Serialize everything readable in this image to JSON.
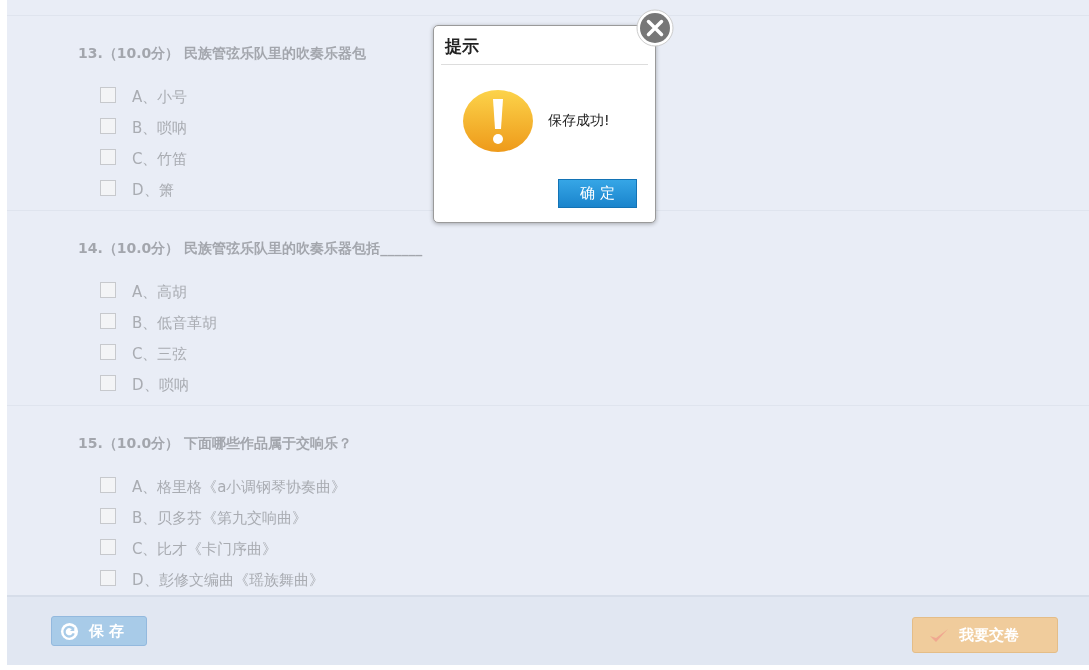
{
  "questions": [
    {
      "number": "13.",
      "score": "（10.0分）",
      "text": "民族管弦乐队里的吹奏乐器包",
      "options": [
        {
          "label": "A、小号",
          "checked": false
        },
        {
          "label": "B、唢呐",
          "checked": false
        },
        {
          "label": "C、竹笛",
          "checked": false
        },
        {
          "label": "D、箫",
          "checked": false
        }
      ]
    },
    {
      "number": "14.",
      "score": "（10.0分）",
      "text": "民族管弦乐队里的吹奏乐器包括______",
      "options": [
        {
          "label": "A、高胡",
          "checked": false
        },
        {
          "label": "B、低音革胡",
          "checked": false
        },
        {
          "label": "C、三弦",
          "checked": false
        },
        {
          "label": "D、唢呐",
          "checked": false
        }
      ]
    },
    {
      "number": "15.",
      "score": "（10.0分）",
      "text": "下面哪些作品属于交响乐？",
      "options": [
        {
          "label": "A、格里格《a小调钢琴协奏曲》",
          "checked": false
        },
        {
          "label": "B、贝多芬《第九交响曲》",
          "checked": false
        },
        {
          "label": "C、比才《卡门序曲》",
          "checked": false
        },
        {
          "label": "D、彭修文编曲《瑶族舞曲》",
          "checked": false
        }
      ]
    }
  ],
  "footer": {
    "save_button": "保 存",
    "submit_button": "我要交卷"
  },
  "dialog": {
    "title": "提示",
    "message": "保存成功!",
    "ok_button": "确 定"
  }
}
